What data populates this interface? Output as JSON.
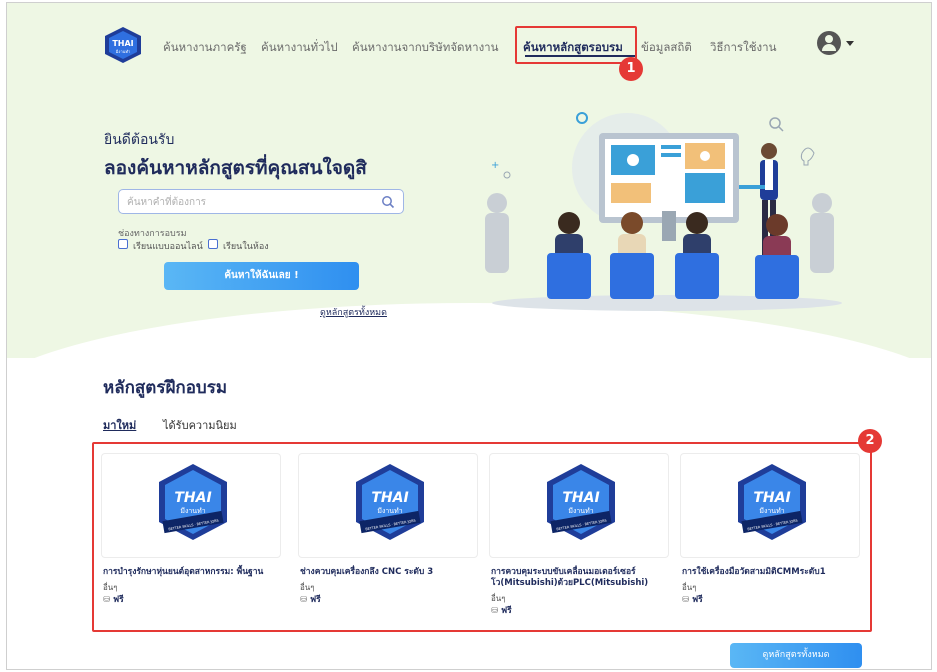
{
  "nav": {
    "items": [
      "ค้นหางานภาครัฐ",
      "ค้นหางานทั่วไป",
      "ค้นหางานจากบริษัทจัดหางาน",
      "ค้นหาหลักสูตรอบรม",
      "ข้อมูลสถิติ",
      "วิธีการใช้งาน"
    ],
    "logo_text": "THAI",
    "logo_sub": "มีงานทำ"
  },
  "callouts": {
    "one": "1",
    "two": "2"
  },
  "hero": {
    "welcome": "ยินดีต้อนรับ",
    "headline": "ลองค้นหาหลักสูตรที่คุณสนใจดูสิ",
    "search_placeholder": "ค้นหาคำที่ต้องการ",
    "channel_label": "ช่องทางการอบรม",
    "online_label": "เรียนแบบออนไลน์",
    "classroom_label": "เรียนในห้อง",
    "search_button": "ค้นหาให้ฉันเลย !",
    "all_courses_link": "ดูหลักสูตรทั้งหมด"
  },
  "courses": {
    "title": "หลักสูตรฝึกอบรม",
    "tabs": [
      "มาใหม่",
      "ได้รับความนิยม"
    ],
    "logo_text": "THAI",
    "logo_sub": "มีงานทำ",
    "logo_ring": "BETTER SKILLS · BETTER JOBS",
    "items": [
      {
        "title": "การบำรุงรักษาหุ่นยนต์อุตสาหกรรม: พื้นฐาน",
        "category": "อื่นๆ",
        "price": "ฟรี"
      },
      {
        "title": "ช่างควบคุมเครื่องกลึง CNC ระดับ 3",
        "category": "อื่นๆ",
        "price": "ฟรี"
      },
      {
        "title": "การควบคุมระบบขับเคลื่อนมอเตอร์เซอร์โว(Mitsubishi)ด้วยPLC(Mitsubishi)",
        "category": "อื่นๆ",
        "price": "ฟรี"
      },
      {
        "title": "การใช้เครื่องมือวัดสามมิติCMMระดับ1",
        "category": "อื่นๆ",
        "price": "ฟรี"
      }
    ],
    "all_button": "ดูหลักสูตรทั้งหมด"
  },
  "colors": {
    "navy": "#1f2b5c",
    "accent": "#2f8ff0",
    "callout": "#e53935",
    "hero_bg": "#eef7e4"
  }
}
